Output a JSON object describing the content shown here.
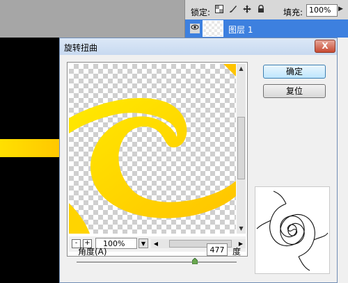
{
  "layers_panel": {
    "lock_label": "锁定:",
    "lock_icons": [
      "transparency-lock-icon",
      "brush-lock-icon",
      "move-lock-icon",
      "padlock-icon"
    ],
    "fill_label": "填充:",
    "fill_value": "100%",
    "layer_name": "图层 1"
  },
  "dialog": {
    "title": "旋转扭曲",
    "close_label": "X",
    "ok_label": "确定",
    "reset_label": "复位",
    "zoom": {
      "minus_label": "-",
      "plus_label": "+",
      "value": "100%"
    },
    "angle": {
      "label": "角度(A)",
      "value": "477",
      "unit": "度",
      "slider_min": -999,
      "slider_max": 999,
      "slider_value": 477
    }
  },
  "colors": {
    "swirl_yellow": "#ffea00",
    "swirl_orange": "#ffc400",
    "layer_highlight": "#3d80df"
  }
}
